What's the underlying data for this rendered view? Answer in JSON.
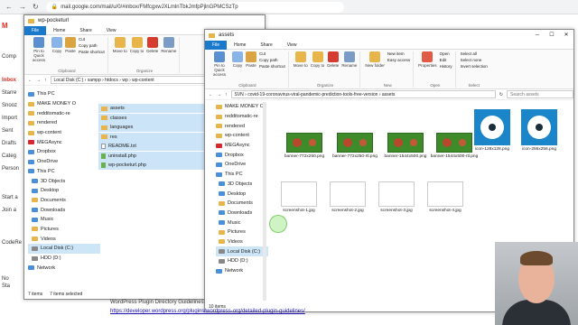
{
  "browser": {
    "url": "mail.google.com/mail/u/0/#inbox/FMfcgxwJXLmlnTbkJmfpPjlnGPMCSzTp"
  },
  "gmail": {
    "logo": "M",
    "compose": "Comp",
    "items": [
      "Inbox",
      "Starre",
      "Snooz",
      "Import",
      "Sent",
      "Drafts",
      "Categ",
      "Person",
      "Start a",
      "Join a",
      "No",
      "Sta",
      "CodeRe"
    ]
  },
  "back_window": {
    "title": "wp-pocketurl",
    "tabs": [
      "File",
      "Home",
      "Share",
      "View"
    ],
    "ribbon": {
      "pin": "Pin to Quick access",
      "copy": "Copy",
      "paste": "Paste",
      "cut": "Cut",
      "copy_path": "Copy path",
      "paste_shortcut": "Paste shortcut",
      "move_to": "Move to",
      "copy_to": "Copy to",
      "delete": "Delete",
      "rename": "Rename",
      "clipboard_group": "Clipboard",
      "organize_group": "Organize"
    },
    "path": "Local Disk (C:) › xampp › htdocs › wp › wp-content",
    "nav": [
      "This PC",
      "MAKE MONEY O",
      "redditomatic-re",
      "rendered",
      "wp-content",
      "MEGAsync",
      "Dropbox",
      "OneDrive",
      "This PC",
      "3D Objects",
      "Desktop",
      "Documents",
      "Downloads",
      "Music",
      "Pictures",
      "Videos",
      "Local Disk (C:)",
      "HDD (D:)",
      "Network"
    ],
    "files": [
      "assets",
      "classes",
      "languages",
      "res",
      "README.txt",
      "uninstall.php",
      "wp-pocketurl.php"
    ],
    "status_items": "7 items",
    "status_selected": "7 items selected"
  },
  "front_window": {
    "title": "assets",
    "tabs": [
      "File",
      "Home",
      "Share",
      "View"
    ],
    "ribbon": {
      "pin": "Pin to Quick access",
      "copy": "Copy",
      "paste": "Paste",
      "cut": "Cut",
      "copy_path": "Copy path",
      "paste_shortcut": "Paste shortcut",
      "move_to": "Move to",
      "copy_to": "Copy to",
      "delete": "Delete",
      "rename": "Rename",
      "new_folder": "New folder",
      "new_item": "New item",
      "easy_access": "Easy access",
      "properties": "Properties",
      "open": "Open",
      "edit": "Edit",
      "history": "History",
      "select_all": "Select all",
      "select_none": "Select none",
      "invert_selection": "Invert selection",
      "clipboard_group": "Clipboard",
      "organize_group": "Organize",
      "new_group": "New",
      "open_group": "Open",
      "select_group": "Select"
    },
    "path": "SVN › covid-19-coronavirus-viral-pandemic-prediction-tools-free-version › assets",
    "search_placeholder": "Search assets",
    "nav": [
      "MAKE MONEY O",
      "redditomatic-re",
      "rendered",
      "wp-content",
      "MEGAsync",
      "Dropbox",
      "OneDrive",
      "This PC",
      "3D Objects",
      "Desktop",
      "Documents",
      "Downloads",
      "Music",
      "Pictures",
      "Videos",
      "Local Disk (C:)",
      "HDD (D:)",
      "Network"
    ],
    "files": [
      {
        "name": "banner-772x250.png",
        "kind": "banner"
      },
      {
        "name": "banner-772x250-rtl.png",
        "kind": "banner"
      },
      {
        "name": "banner-1544x500.png",
        "kind": "banner"
      },
      {
        "name": "banner-1544x500-rtl.png",
        "kind": "banner"
      },
      {
        "name": "icon-128x128.png",
        "kind": "icon"
      },
      {
        "name": "icon-256x256.png",
        "kind": "icon"
      },
      {
        "name": "screenshot-1.jpg",
        "kind": "shot"
      },
      {
        "name": "screenshot-2.jpg",
        "kind": "shot"
      },
      {
        "name": "screenshot-3.jpg",
        "kind": "shot"
      },
      {
        "name": "screenshot-4.jpg",
        "kind": "shot"
      }
    ],
    "status_items": "10 items"
  },
  "page_text": {
    "line1": "WordPress Plugin Directory Guidelines:",
    "line2": "https://developer.wordpress.org/plugins/wordpress-org/detailed-plugin-guidelines/"
  },
  "colors": {
    "accent": "#1979ca",
    "gmail_red": "#d93025",
    "folder": "#e8b54a"
  }
}
